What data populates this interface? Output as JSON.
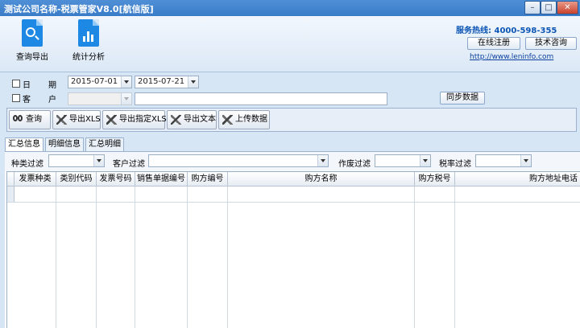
{
  "window": {
    "title": "测试公司名称-税票管家V8.0[航信版]",
    "min_symbol": "–",
    "max_symbol": "□",
    "close_symbol": "✕"
  },
  "header": {
    "tools": [
      {
        "label": "查询导出",
        "icon": "magnifier-document-icon"
      },
      {
        "label": "统计分析",
        "icon": "bar-chart-document-icon"
      }
    ],
    "hotline": "服务热线: 4000-598-355",
    "register_label": "在线注册",
    "tech_label": "技术咨询",
    "website": "http://www.leninfo.com"
  },
  "filter": {
    "date_label_1": "日",
    "date_label_2": "期",
    "date_from": "2015-07-01",
    "date_to": "2015-07-21",
    "customer_label_1": "客",
    "customer_label_2": "户",
    "customer_select": "",
    "customer_text": "",
    "sync_label": "同步数据"
  },
  "toolbar": {
    "query": "查询",
    "export_xls": "导出XLS",
    "export_specified_xls": "导出指定XLS",
    "export_text": "导出文本",
    "upload_data": "上传数据"
  },
  "tabs": [
    "汇总信息",
    "明细信息",
    "汇总明细"
  ],
  "grid_filters": {
    "type_label": "种类过滤",
    "customer_label": "客户过滤",
    "void_label": "作废过滤",
    "taxrate_label": "税率过滤"
  },
  "grid": {
    "columns": [
      "发票种类",
      "类别代码",
      "发票号码",
      "销售单据编号",
      "购方编号",
      "购方名称",
      "购方税号",
      "购方地址电话"
    ]
  }
}
